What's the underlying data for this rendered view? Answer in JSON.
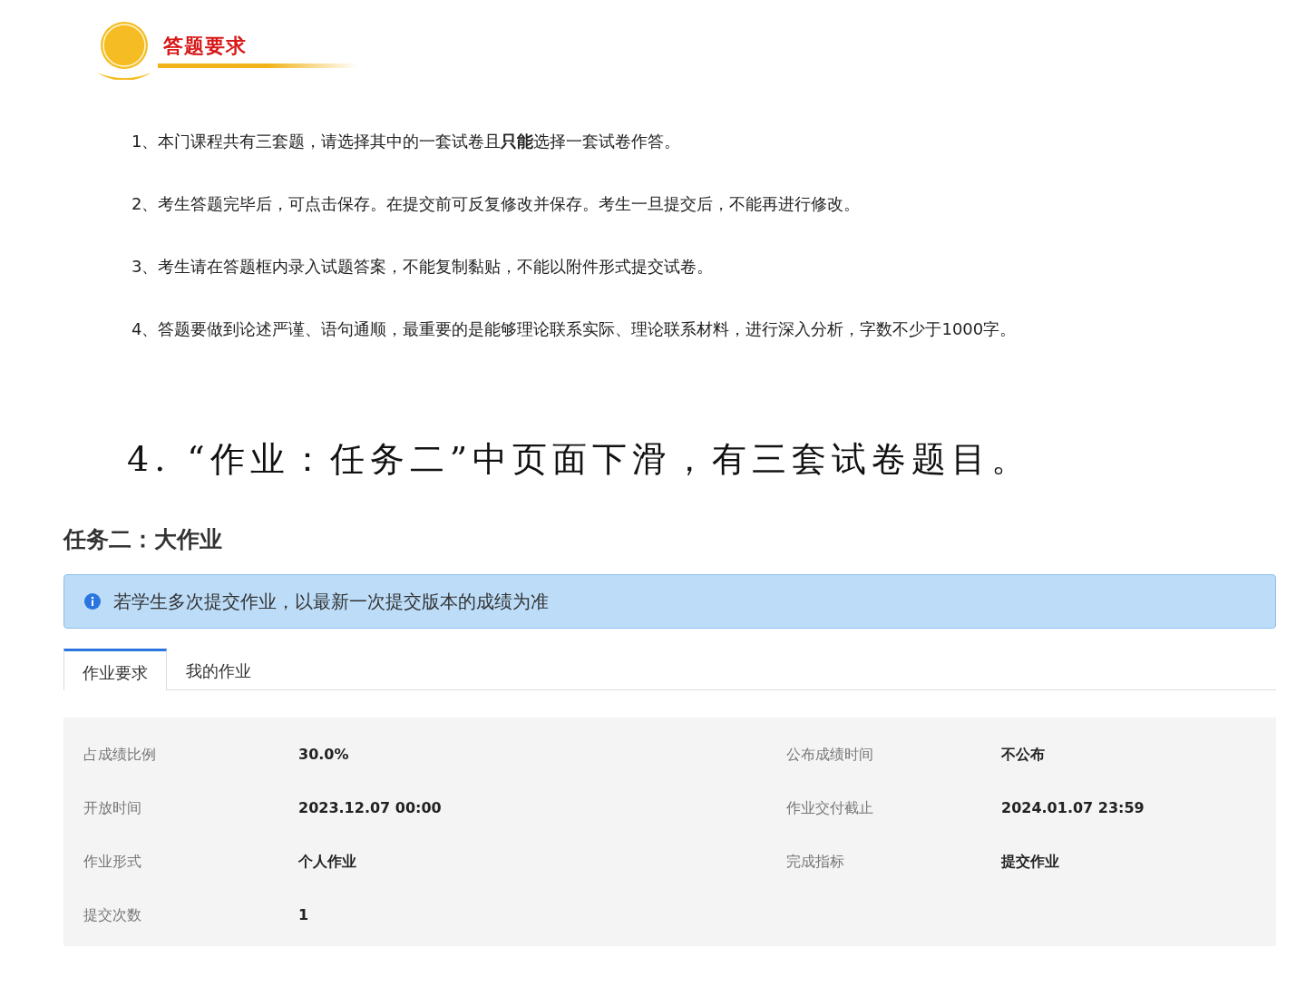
{
  "section_heading": {
    "title": "答题要求"
  },
  "rules": [
    "1、本门课程共有三套题，请选择其中的一套试卷且**只能**选择一套试卷作答。",
    "2、考生答题完毕后，可点击保存。在提交前可反复修改并保存。考生一旦提交后，不能再进行修改。",
    "3、考生请在答题框内录入试题答案，不能复制黏贴，不能以附件形式提交试卷。",
    "4、答题要做到论述严谨、语句通顺，最重要的是能够理论联系实际、理论联系材料，进行深入分析，字数不少于1000字。"
  ],
  "step_caption": "4. “作业：任务二”中页面下滑，有三套试卷题目。",
  "task": {
    "title": "任务二：大作业",
    "notice": "若学生多次提交作业，以最新一次提交版本的成绩为准",
    "tabs": [
      {
        "label": "作业要求",
        "selected": true
      },
      {
        "label": "我的作业",
        "selected": false
      }
    ],
    "details": [
      {
        "label": "占成绩比例",
        "value": "30.0%"
      },
      {
        "label": "公布成绩时间",
        "value": "不公布"
      },
      {
        "label": "开放时间",
        "value": "2023.12.07 00:00"
      },
      {
        "label": "作业交付截止",
        "value": "2024.01.07 23:59"
      },
      {
        "label": "作业形式",
        "value": "个人作业"
      },
      {
        "label": "完成指标",
        "value": "提交作业"
      },
      {
        "label": "提交次数",
        "value": "1"
      }
    ]
  }
}
